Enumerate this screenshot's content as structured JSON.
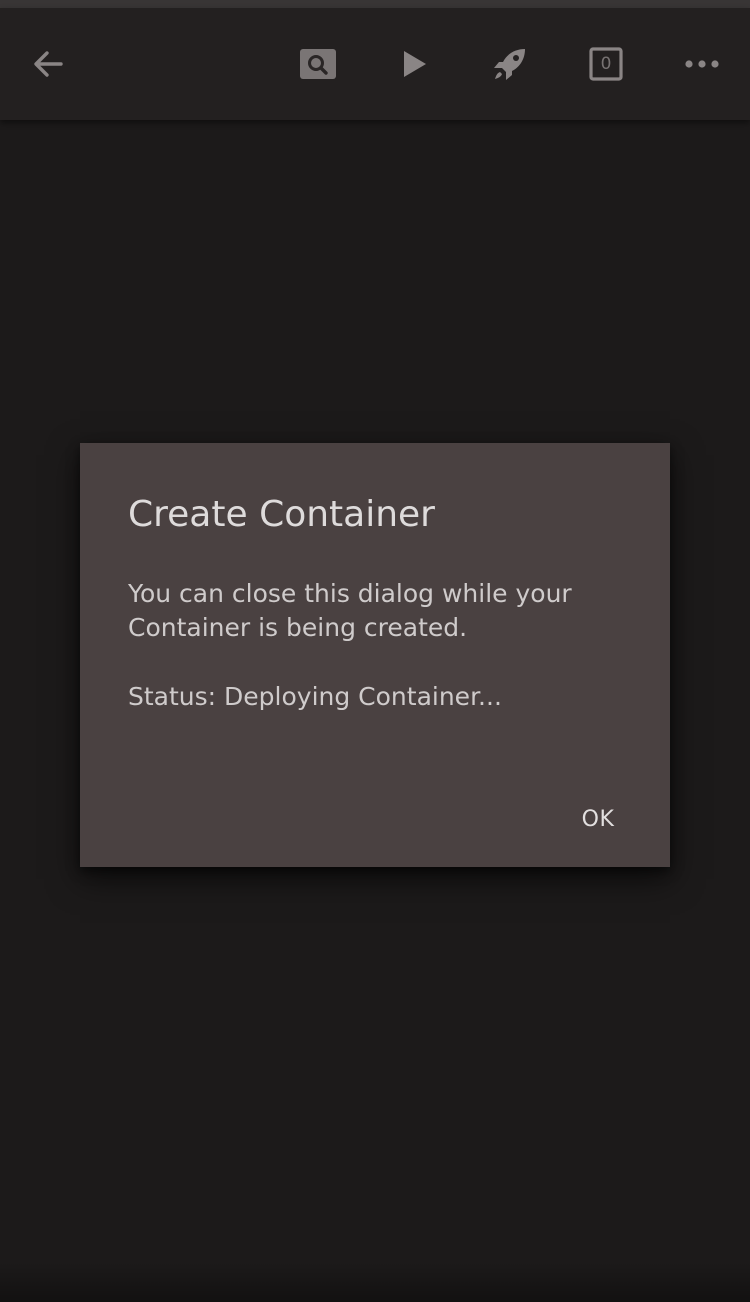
{
  "app_bar": {
    "actions": [
      {
        "name": "back",
        "icon": "arrow-left-icon"
      },
      {
        "name": "search",
        "icon": "search-icon"
      },
      {
        "name": "run",
        "icon": "play-icon"
      },
      {
        "name": "deploy",
        "icon": "rocket-icon"
      },
      {
        "name": "tabs",
        "icon": "tab-counter-icon",
        "count": "0"
      },
      {
        "name": "more",
        "icon": "more-horizontal-icon"
      }
    ]
  },
  "dialog": {
    "title": "Create Container",
    "message": "You can close this dialog while your Container is being created.",
    "status": "Status: Deploying Container...",
    "ok_label": "OK"
  },
  "colors": {
    "background": "#1c1a1a",
    "app_bar": "#232020",
    "dialog": "#4a4141",
    "icon": "#8a8585"
  }
}
